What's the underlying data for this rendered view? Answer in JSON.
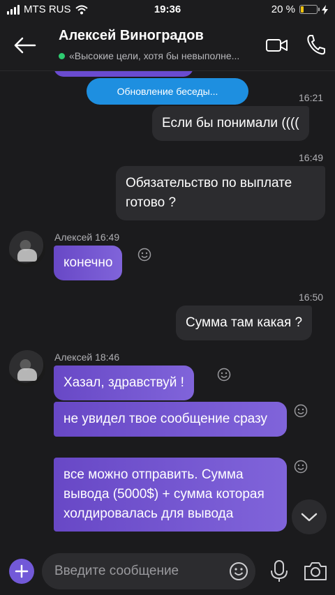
{
  "status_bar": {
    "carrier": "MTS RUS",
    "time": "19:36",
    "battery": "20 %",
    "battery_level": 0.2
  },
  "header": {
    "contact_name": "Алексей Виноградов",
    "status_text": "«Высокие цели, хотя бы невыполне...",
    "icons": [
      "back-arrow-icon",
      "video-call-icon",
      "phone-icon"
    ]
  },
  "chat": {
    "update_pill": "Обновление беседы...",
    "messages": [
      {
        "side": "out",
        "time": "16:21",
        "text": "Если бы понимали (((("
      },
      {
        "side": "out",
        "time": "16:49",
        "text": "Обязательство по выплате готово ?"
      },
      {
        "side": "in",
        "sender": "Алексей 16:49",
        "text": "конечно"
      },
      {
        "side": "out",
        "time": "16:50",
        "text": "Сумма там какая ?"
      },
      {
        "side": "in",
        "sender": "Алексей 18:46",
        "text": "Хазал, здравствуй !"
      },
      {
        "side": "in",
        "text": "не увидел твое сообщение сразу"
      },
      {
        "side": "in",
        "text": "все можно отправить. Сумма вывода (5000$) + сумма которая холдировалась для вывода"
      }
    ]
  },
  "composer": {
    "placeholder": "Введите сообщение",
    "icons": [
      "plus-icon",
      "emoji-icon",
      "microphone-icon",
      "camera-icon",
      "chevron-down-icon"
    ]
  }
}
